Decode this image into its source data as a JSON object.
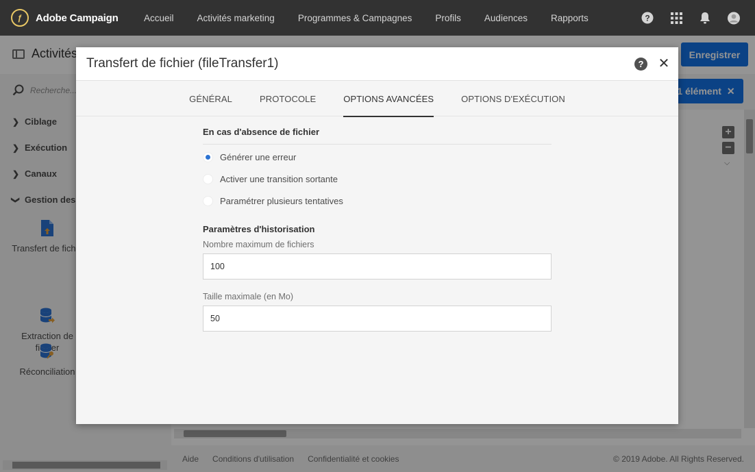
{
  "app": {
    "name": "Adobe Campaign"
  },
  "nav": {
    "items": [
      "Accueil",
      "Activités marketing",
      "Programmes & Campagnes",
      "Profils",
      "Audiences",
      "Rapports"
    ]
  },
  "background": {
    "page_title": "Activités",
    "save_button": "Enregistrer",
    "selection_badge": "1 élément",
    "search_placeholder": "Recherche...",
    "categories": [
      "Ciblage",
      "Exécution",
      "Canaux",
      "Gestion des d"
    ],
    "activities": [
      "Transfert de fichie",
      "Extraction de\nfichier",
      "Réconciliation"
    ],
    "footer": {
      "links": [
        "Aide",
        "Conditions d'utilisation",
        "Confidentialité et cookies"
      ],
      "copyright": "© 2019 Adobe. All Rights Reserved."
    }
  },
  "modal": {
    "title": "Transfert de fichier (fileTransfer1)",
    "tabs": [
      "GÉNÉRAL",
      "PROTOCOLE",
      "OPTIONS AVANCÉES",
      "OPTIONS D'EXÉCUTION"
    ],
    "active_tab": "OPTIONS AVANCÉES",
    "missing_file_section": {
      "title": "En cas d'absence de fichier",
      "options": [
        "Générer une erreur",
        "Activer une transition sortante",
        "Paramétrer plusieurs tentatives"
      ],
      "selected": "Générer une erreur"
    },
    "history_section": {
      "title": "Paramètres d'historisation",
      "max_files_label": "Nombre maximum de fichiers",
      "max_files_value": "100",
      "max_size_label": "Taille maximale (en Mo)",
      "max_size_value": "50"
    }
  },
  "colors": {
    "accent": "#1473e6",
    "topbar": "#323232",
    "radio_selected": "#2c73d2"
  }
}
